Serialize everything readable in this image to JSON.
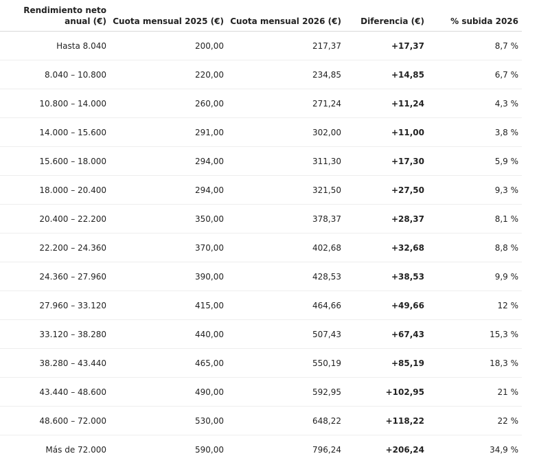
{
  "table": {
    "headers": [
      "Rendimiento neto anual (€)",
      "Cuota mensual 2025 (€)",
      "Cuota mensual 2026 (€)",
      "Diferencia (€)",
      "% subida 2026"
    ],
    "rows": [
      [
        "Hasta 8.040",
        "200,00",
        "217,37",
        "+17,37",
        "8,7 %"
      ],
      [
        "8.040 – 10.800",
        "220,00",
        "234,85",
        "+14,85",
        "6,7 %"
      ],
      [
        "10.800 – 14.000",
        "260,00",
        "271,24",
        "+11,24",
        "4,3 %"
      ],
      [
        "14.000 – 15.600",
        "291,00",
        "302,00",
        "+11,00",
        "3,8 %"
      ],
      [
        "15.600 – 18.000",
        "294,00",
        "311,30",
        "+17,30",
        "5,9 %"
      ],
      [
        "18.000 – 20.400",
        "294,00",
        "321,50",
        "+27,50",
        "9,3 %"
      ],
      [
        "20.400 – 22.200",
        "350,00",
        "378,37",
        "+28,37",
        "8,1 %"
      ],
      [
        "22.200 – 24.360",
        "370,00",
        "402,68",
        "+32,68",
        "8,8 %"
      ],
      [
        "24.360 – 27.960",
        "390,00",
        "428,53",
        "+38,53",
        "9,9 %"
      ],
      [
        "27.960 – 33.120",
        "415,00",
        "464,66",
        "+49,66",
        "12 %"
      ],
      [
        "33.120 – 38.280",
        "440,00",
        "507,43",
        "+67,43",
        "15,3 %"
      ],
      [
        "38.280 – 43.440",
        "465,00",
        "550,19",
        "+85,19",
        "18,3 %"
      ],
      [
        "43.440 – 48.600",
        "490,00",
        "592,95",
        "+102,95",
        "21 %"
      ],
      [
        "48.600 – 72.000",
        "530,00",
        "648,22",
        "+118,22",
        "22 %"
      ],
      [
        "Más de 72.000",
        "590,00",
        "796,24",
        "+206,24",
        "34,9 %"
      ]
    ]
  }
}
